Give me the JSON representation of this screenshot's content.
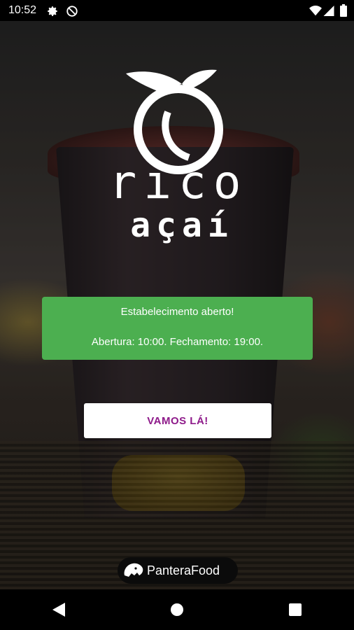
{
  "status_bar": {
    "time": "10:52",
    "icons": [
      "settings-icon",
      "do-not-disturb-icon",
      "wifi-icon",
      "signal-icon",
      "battery-icon"
    ]
  },
  "logo": {
    "line1": "rico",
    "line2": "açaí"
  },
  "store_status": {
    "message": "Estabelecimento aberto!",
    "hours": "Abertura: 10:00. Fechamento: 19:00.",
    "color": "#4caf50"
  },
  "cta": {
    "label": "VAMOS LÁ!",
    "text_color": "#8e1a8a"
  },
  "brand": {
    "name": "PanteraFood"
  },
  "nav": {
    "buttons": [
      "back-icon",
      "home-icon",
      "recents-icon"
    ]
  }
}
